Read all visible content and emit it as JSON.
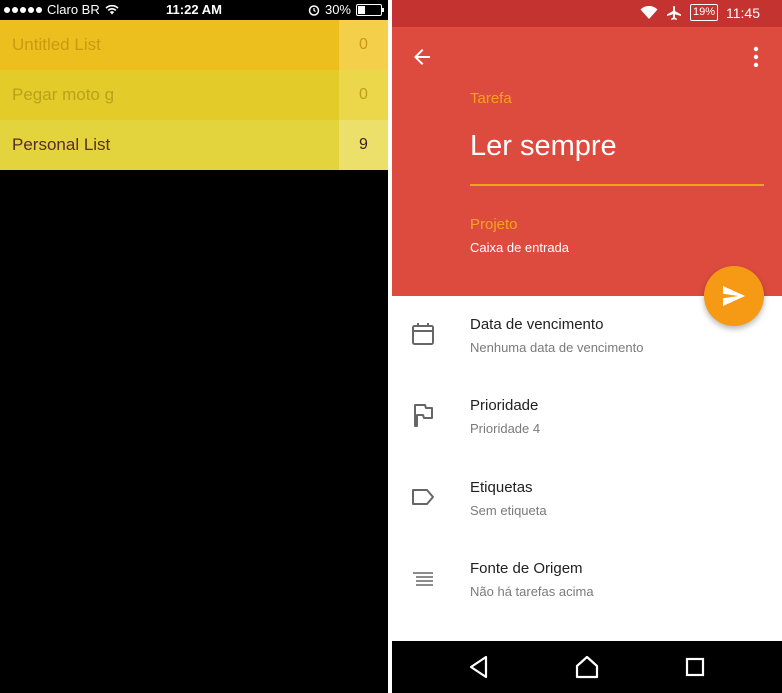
{
  "ios": {
    "status": {
      "carrier": "Claro BR",
      "time": "11:22 AM",
      "battery": "30%",
      "battery_level": 0.3
    },
    "lists": [
      {
        "name": "Untitled List",
        "count": "0"
      },
      {
        "name": "Pegar moto g",
        "count": "0"
      },
      {
        "name": "Personal List",
        "count": "9"
      }
    ]
  },
  "android": {
    "status": {
      "battery": "19%",
      "time": "11:45"
    },
    "task": {
      "label": "Tarefa",
      "title": "Ler sempre",
      "project_label": "Projeto",
      "project_value": "Caixa de entrada"
    },
    "items": [
      {
        "title": "Data de vencimento",
        "subtitle": "Nenhuma data de vencimento",
        "icon": "calendar-icon"
      },
      {
        "title": "Prioridade",
        "subtitle": "Prioridade 4",
        "icon": "flag-icon"
      },
      {
        "title": "Etiquetas",
        "subtitle": "Sem etiqueta",
        "icon": "label-icon"
      },
      {
        "title": "Fonte de Origem",
        "subtitle": "Não há tarefas acima",
        "icon": "indent-lines-icon"
      }
    ],
    "colors": {
      "status_bar": "#c53330",
      "header": "#dc4b3e",
      "accent": "#f6a31c",
      "fab": "#f69a16"
    }
  }
}
